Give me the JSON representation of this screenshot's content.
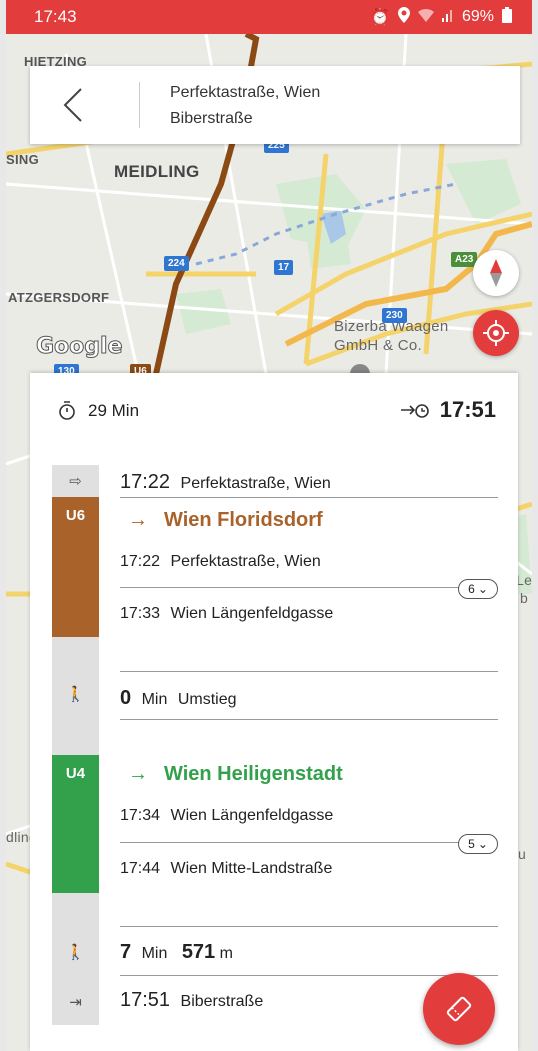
{
  "status_bar": {
    "time": "17:43",
    "battery": "69%"
  },
  "map": {
    "labels": [
      "HIETZING",
      "SING",
      "MEIDLING",
      "ATZGERSDORF",
      "Bizerba Waagen",
      "GmbH & Co.",
      "Leo",
      "b",
      "dling",
      "u"
    ],
    "shields": [
      "225",
      "224",
      "17",
      "A23",
      "230",
      "130",
      "U6"
    ],
    "google": "Google"
  },
  "search": {
    "from": "Perfektastraße, Wien",
    "to": "Biberstraße"
  },
  "summary": {
    "duration": "29 Min",
    "arrival_time": "17:51"
  },
  "legs": {
    "start": {
      "time": "17:22",
      "stop": "Perfektastraße, Wien"
    },
    "u6": {
      "line": "U6",
      "color": "#a8622a",
      "direction": "Wien Floridsdorf",
      "from_time": "17:22",
      "from_stop": "Perfektastraße, Wien",
      "to_time": "17:33",
      "to_stop": "Wien Längenfeldgasse",
      "stops": "6"
    },
    "transfer": {
      "minutes": "0",
      "unit": "Min",
      "label": "Umstieg"
    },
    "u4": {
      "line": "U4",
      "color": "#33a04b",
      "direction": "Wien Heiligenstadt",
      "from_time": "17:34",
      "from_stop": "Wien Längenfeldgasse",
      "to_time": "17:44",
      "to_stop": "Wien Mitte-Landstraße",
      "stops": "5"
    },
    "walk": {
      "minutes": "7",
      "min_unit": "Min",
      "distance": "571",
      "dist_unit": "m"
    },
    "end": {
      "time": "17:51",
      "stop": "Biberstraße"
    }
  },
  "colors": {
    "accent": "#e23c3c",
    "u6": "#a8622a",
    "u4": "#33a04b"
  },
  "icons": [
    "back-icon",
    "alarm-icon",
    "location-icon",
    "wifi-icon",
    "signal-icon",
    "battery-icon",
    "compass-icon",
    "locate-icon",
    "stopwatch-icon",
    "arrival-icon",
    "start-icon",
    "walk-icon",
    "end-icon",
    "chevron-down-icon",
    "ticket-icon"
  ]
}
